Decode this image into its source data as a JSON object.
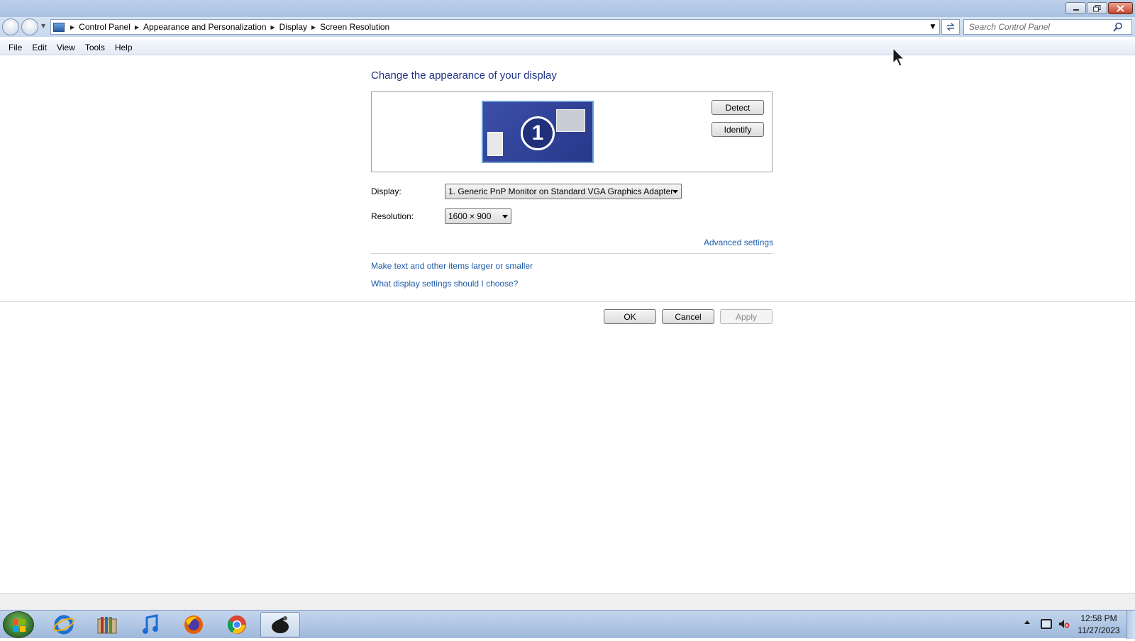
{
  "window": {
    "controls": {
      "minimize": "minimize",
      "maximize": "restore",
      "close": "close"
    }
  },
  "address": {
    "icon": "control-panel-icon",
    "breadcrumbs": [
      "Control Panel",
      "Appearance and Personalization",
      "Display",
      "Screen Resolution"
    ],
    "search_placeholder": "Search Control Panel"
  },
  "menu": [
    "File",
    "Edit",
    "View",
    "Tools",
    "Help"
  ],
  "main": {
    "title": "Change the appearance of your display",
    "monitor_number": "1",
    "detect_label": "Detect",
    "identify_label": "Identify",
    "display_label": "Display:",
    "display_value": "1. Generic PnP Monitor on Standard VGA Graphics Adapter",
    "resolution_label": "Resolution:",
    "resolution_value": "1600 × 900",
    "advanced_link": "Advanced settings",
    "text_size_link": "Make text and other items larger or smaller",
    "help_link": "What display settings should I choose?",
    "ok_label": "OK",
    "cancel_label": "Cancel",
    "apply_label": "Apply"
  },
  "taskbar": {
    "apps": [
      "internet-explorer-icon",
      "library-icon",
      "music-note-icon",
      "firefox-icon",
      "chrome-icon",
      "control-panel-app-icon"
    ],
    "active_app": "control-panel-app-icon",
    "time": "12:58 PM",
    "date": "11/27/2023"
  },
  "colors": {
    "accent_link": "#1e5aa8",
    "title_text": "#1e3287",
    "monitor_fill": "#3c4fa8"
  }
}
